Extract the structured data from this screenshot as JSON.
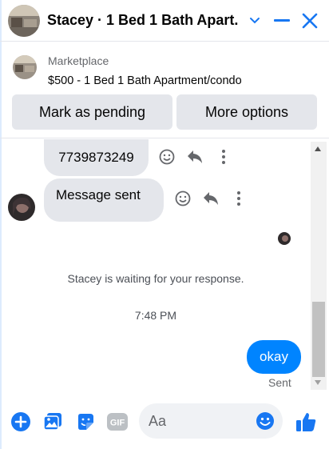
{
  "header": {
    "title": "Stacey · 1 Bed 1 Bath Apart...",
    "icons": [
      "chevron-down-icon",
      "minimize-icon",
      "close-icon"
    ]
  },
  "listing": {
    "label": "Marketplace",
    "title": "$500 - 1 Bed 1 Bath Apartment/condo",
    "buttons": {
      "mark_pending": "Mark as pending",
      "more_options": "More options"
    }
  },
  "conversation": {
    "messages_in": [
      {
        "text": "7739873249"
      },
      {
        "text": "Message sent"
      }
    ],
    "waiting_notice": "Stacey is waiting for your response.",
    "timestamp": "7:48 PM",
    "message_out": {
      "text": "okay",
      "status": "Sent"
    }
  },
  "composer": {
    "placeholder": "Aa",
    "icons": [
      "plus-icon",
      "image-icon",
      "sticker-icon",
      "gif-icon",
      "emoji-icon",
      "thumbs-up-icon"
    ],
    "gif_label": "GIF"
  },
  "colors": {
    "accent": "#0084ff",
    "icon_blue": "#1877f2",
    "bubble_gray": "#e4e6eb",
    "muted_text": "#65676b"
  }
}
